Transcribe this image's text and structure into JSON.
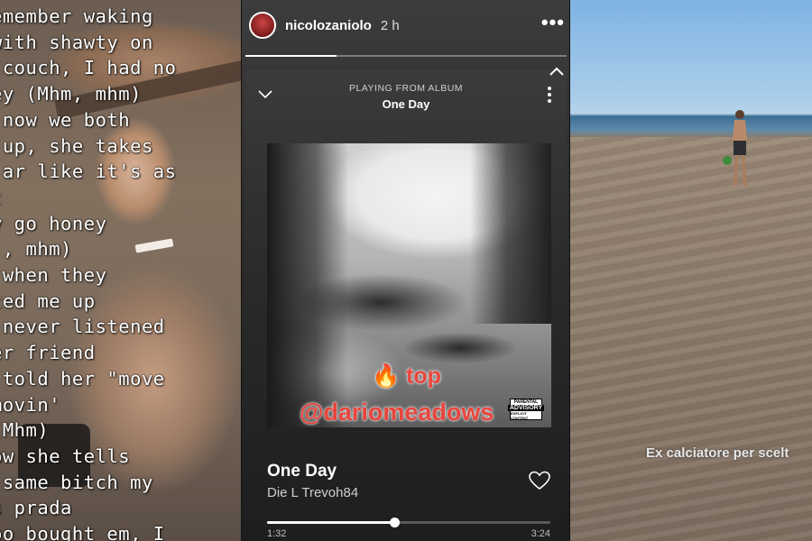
{
  "left_panel": {
    "lyrics": "emember waking\nwith shawty on\n couch, I had no\ney (Mhm, mhm)\n now we both\n up, she takes\n ar like it's as\nt\ny go honey\n , mhm)\n when they\nted me up\n never listened\ner friend\n told her \"move\nmovin'\n(Mhm)\now she tells\n same bitch my\ns prada\noo bought em, I"
  },
  "story": {
    "username": "nicolozaniolo",
    "time": "2 h",
    "more_label": "•••",
    "progress": 0.285
  },
  "spotify": {
    "playing_from": "PLAYING FROM ALBUM",
    "album": "One Day",
    "track_title": "One Day",
    "artist": "Die L Trevoh84",
    "elapsed": "1:32",
    "total": "3:24",
    "progress": 0.45,
    "advisory_line1": "PARENTAL",
    "advisory_line2": "ADVISORY",
    "advisory_line3": "EXPLICIT CONTENT"
  },
  "stickers": {
    "top": "🔥 top",
    "handle": "@dariomeadows"
  },
  "right_panel": {
    "caption": "Ex calciatore per scelt"
  },
  "icons": {
    "collapse": "chevron-down-icon",
    "menu": "vertical-dots-icon",
    "like": "heart-icon",
    "close_story": "chevron-up-icon"
  },
  "colors": {
    "sticker_red": "#e8453c",
    "spotify_bg": "#282828"
  }
}
